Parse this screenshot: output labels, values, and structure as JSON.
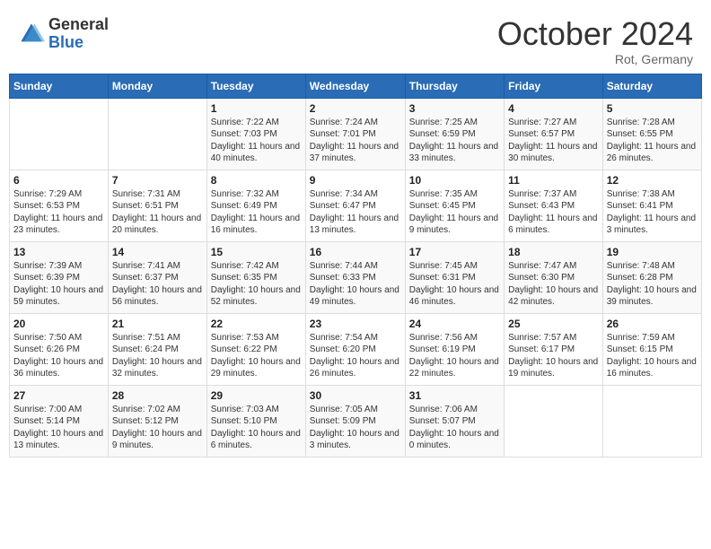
{
  "header": {
    "logo_general": "General",
    "logo_blue": "Blue",
    "month_title": "October 2024",
    "location": "Rot, Germany"
  },
  "days_of_week": [
    "Sunday",
    "Monday",
    "Tuesday",
    "Wednesday",
    "Thursday",
    "Friday",
    "Saturday"
  ],
  "weeks": [
    [
      {
        "day": "",
        "sunrise": "",
        "sunset": "",
        "daylight": ""
      },
      {
        "day": "",
        "sunrise": "",
        "sunset": "",
        "daylight": ""
      },
      {
        "day": "1",
        "sunrise": "Sunrise: 7:22 AM",
        "sunset": "Sunset: 7:03 PM",
        "daylight": "Daylight: 11 hours and 40 minutes."
      },
      {
        "day": "2",
        "sunrise": "Sunrise: 7:24 AM",
        "sunset": "Sunset: 7:01 PM",
        "daylight": "Daylight: 11 hours and 37 minutes."
      },
      {
        "day": "3",
        "sunrise": "Sunrise: 7:25 AM",
        "sunset": "Sunset: 6:59 PM",
        "daylight": "Daylight: 11 hours and 33 minutes."
      },
      {
        "day": "4",
        "sunrise": "Sunrise: 7:27 AM",
        "sunset": "Sunset: 6:57 PM",
        "daylight": "Daylight: 11 hours and 30 minutes."
      },
      {
        "day": "5",
        "sunrise": "Sunrise: 7:28 AM",
        "sunset": "Sunset: 6:55 PM",
        "daylight": "Daylight: 11 hours and 26 minutes."
      }
    ],
    [
      {
        "day": "6",
        "sunrise": "Sunrise: 7:29 AM",
        "sunset": "Sunset: 6:53 PM",
        "daylight": "Daylight: 11 hours and 23 minutes."
      },
      {
        "day": "7",
        "sunrise": "Sunrise: 7:31 AM",
        "sunset": "Sunset: 6:51 PM",
        "daylight": "Daylight: 11 hours and 20 minutes."
      },
      {
        "day": "8",
        "sunrise": "Sunrise: 7:32 AM",
        "sunset": "Sunset: 6:49 PM",
        "daylight": "Daylight: 11 hours and 16 minutes."
      },
      {
        "day": "9",
        "sunrise": "Sunrise: 7:34 AM",
        "sunset": "Sunset: 6:47 PM",
        "daylight": "Daylight: 11 hours and 13 minutes."
      },
      {
        "day": "10",
        "sunrise": "Sunrise: 7:35 AM",
        "sunset": "Sunset: 6:45 PM",
        "daylight": "Daylight: 11 hours and 9 minutes."
      },
      {
        "day": "11",
        "sunrise": "Sunrise: 7:37 AM",
        "sunset": "Sunset: 6:43 PM",
        "daylight": "Daylight: 11 hours and 6 minutes."
      },
      {
        "day": "12",
        "sunrise": "Sunrise: 7:38 AM",
        "sunset": "Sunset: 6:41 PM",
        "daylight": "Daylight: 11 hours and 3 minutes."
      }
    ],
    [
      {
        "day": "13",
        "sunrise": "Sunrise: 7:39 AM",
        "sunset": "Sunset: 6:39 PM",
        "daylight": "Daylight: 10 hours and 59 minutes."
      },
      {
        "day": "14",
        "sunrise": "Sunrise: 7:41 AM",
        "sunset": "Sunset: 6:37 PM",
        "daylight": "Daylight: 10 hours and 56 minutes."
      },
      {
        "day": "15",
        "sunrise": "Sunrise: 7:42 AM",
        "sunset": "Sunset: 6:35 PM",
        "daylight": "Daylight: 10 hours and 52 minutes."
      },
      {
        "day": "16",
        "sunrise": "Sunrise: 7:44 AM",
        "sunset": "Sunset: 6:33 PM",
        "daylight": "Daylight: 10 hours and 49 minutes."
      },
      {
        "day": "17",
        "sunrise": "Sunrise: 7:45 AM",
        "sunset": "Sunset: 6:31 PM",
        "daylight": "Daylight: 10 hours and 46 minutes."
      },
      {
        "day": "18",
        "sunrise": "Sunrise: 7:47 AM",
        "sunset": "Sunset: 6:30 PM",
        "daylight": "Daylight: 10 hours and 42 minutes."
      },
      {
        "day": "19",
        "sunrise": "Sunrise: 7:48 AM",
        "sunset": "Sunset: 6:28 PM",
        "daylight": "Daylight: 10 hours and 39 minutes."
      }
    ],
    [
      {
        "day": "20",
        "sunrise": "Sunrise: 7:50 AM",
        "sunset": "Sunset: 6:26 PM",
        "daylight": "Daylight: 10 hours and 36 minutes."
      },
      {
        "day": "21",
        "sunrise": "Sunrise: 7:51 AM",
        "sunset": "Sunset: 6:24 PM",
        "daylight": "Daylight: 10 hours and 32 minutes."
      },
      {
        "day": "22",
        "sunrise": "Sunrise: 7:53 AM",
        "sunset": "Sunset: 6:22 PM",
        "daylight": "Daylight: 10 hours and 29 minutes."
      },
      {
        "day": "23",
        "sunrise": "Sunrise: 7:54 AM",
        "sunset": "Sunset: 6:20 PM",
        "daylight": "Daylight: 10 hours and 26 minutes."
      },
      {
        "day": "24",
        "sunrise": "Sunrise: 7:56 AM",
        "sunset": "Sunset: 6:19 PM",
        "daylight": "Daylight: 10 hours and 22 minutes."
      },
      {
        "day": "25",
        "sunrise": "Sunrise: 7:57 AM",
        "sunset": "Sunset: 6:17 PM",
        "daylight": "Daylight: 10 hours and 19 minutes."
      },
      {
        "day": "26",
        "sunrise": "Sunrise: 7:59 AM",
        "sunset": "Sunset: 6:15 PM",
        "daylight": "Daylight: 10 hours and 16 minutes."
      }
    ],
    [
      {
        "day": "27",
        "sunrise": "Sunrise: 7:00 AM",
        "sunset": "Sunset: 5:14 PM",
        "daylight": "Daylight: 10 hours and 13 minutes."
      },
      {
        "day": "28",
        "sunrise": "Sunrise: 7:02 AM",
        "sunset": "Sunset: 5:12 PM",
        "daylight": "Daylight: 10 hours and 9 minutes."
      },
      {
        "day": "29",
        "sunrise": "Sunrise: 7:03 AM",
        "sunset": "Sunset: 5:10 PM",
        "daylight": "Daylight: 10 hours and 6 minutes."
      },
      {
        "day": "30",
        "sunrise": "Sunrise: 7:05 AM",
        "sunset": "Sunset: 5:09 PM",
        "daylight": "Daylight: 10 hours and 3 minutes."
      },
      {
        "day": "31",
        "sunrise": "Sunrise: 7:06 AM",
        "sunset": "Sunset: 5:07 PM",
        "daylight": "Daylight: 10 hours and 0 minutes."
      },
      {
        "day": "",
        "sunrise": "",
        "sunset": "",
        "daylight": ""
      },
      {
        "day": "",
        "sunrise": "",
        "sunset": "",
        "daylight": ""
      }
    ]
  ]
}
